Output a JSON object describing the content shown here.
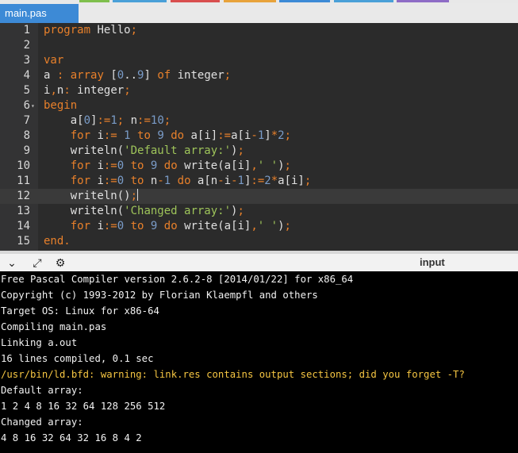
{
  "tab": {
    "label": "main.pas"
  },
  "editor": {
    "line_numbers": [
      "1",
      "2",
      "3",
      "4",
      "5",
      "6",
      "7",
      "8",
      "9",
      "10",
      "11",
      "12",
      "13",
      "14",
      "15"
    ],
    "fold_marker": "▾"
  },
  "toolbar": {
    "icons": [
      "check-chevron-icon",
      "expand-icon",
      "settings-icon"
    ],
    "input_label": "input"
  },
  "console": {
    "lines": [
      "Free Pascal Compiler version 2.6.2-8 [2014/01/22] for x86_64",
      "Copyright (c) 1993-2012 by Florian Klaempfl and others",
      "Target OS: Linux for x86-64",
      "Compiling main.pas",
      "Linking a.out",
      "16 lines compiled, 0.1 sec",
      "/usr/bin/ld.bfd: warning: link.res contains output sections; did you forget -T?",
      "Default array:",
      "1 2 4 8 16 32 64 128 256 512",
      "Changed array:",
      "4 8 16 32 64 32 16 8 4 2"
    ]
  },
  "colors": {
    "keyword": "#e8802b",
    "number": "#7a9cc8",
    "string": "#9ec45a",
    "warning": "#f5c542",
    "tab": "#3d8ad6"
  }
}
